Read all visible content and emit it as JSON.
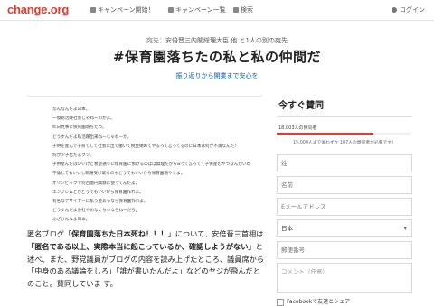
{
  "header_bar": {
    "logo": "change.org",
    "nav_start": "キャンペーン開始！",
    "nav_list": "キャンペーン一覧",
    "nav_search": "検索",
    "login": "ログイン"
  },
  "petition": {
    "addressee_label": "宛先：",
    "addressee": "安倍晋三内閣総理大臣 他 と1人の別の宛先",
    "title": "#保育園落ちたの私と私の仲間だ",
    "link": "振り返りから開業まで安心を"
  },
  "letter_lines": [
    "なんなんだよ日本。",
    "一億総活躍社会じゃねーのかよ。",
    "昨日見事に保育園落ちたわ。",
    "どうすんだよ私活躍出来ねーじゃねーか。",
    "子供を産んで子育てして社会に出て働いて税金納めてやるって言ってるのに日本は何が不満なんだ？",
    "何が少子化だよクソ。",
    "子供産んだはいいけど希望通りに保育園に預けるのほぼ無理だからwって言ってて子供産むやつなんかいねーよ。",
    "不倫してもいいし賄賂受け取るのもどうでもいいから保育園増やせよ。",
    "オリンピックで何百億円無駄に使ってんだよ。",
    "エンブレムとかどうでもいいから保育園作れよ。",
    "有名なデザイナーに払う金あるなら保育園作れよ。",
    "どうすんだよ会社やめなくちゃならねーだろ。",
    "ふざけんなよ日本。"
  ],
  "body": {
    "line1_pre": "匿名ブログ「",
    "line1_bold": "保育園落ちた日本死ね！！！",
    "line1_post": "」について、安倍晋三首相は",
    "line2_bold": "「匿名である以上、実際本当に起こっているか、確認しようがない」",
    "line2_post": "と",
    "line3": "述べ、また、野党議員がブログの内容を読み上げたところ、議員席から",
    "line4": "「中身のある議論をしろ」「誰が書いたんだよ」などのヤジが飛んだと",
    "line5": "のこと。",
    "line5_tail": "賛同していま す。"
  },
  "sidebar": {
    "title": "今すぐ賛同",
    "count_text": "18,003人の賛同者",
    "progress": 0.72,
    "needed_text": "15,000人まで後わずか 107人の賛同者が必要です！",
    "name_first_placeholder": "姓",
    "name_last_placeholder": "名前",
    "email_placeholder": "Eメールアドレス",
    "country": "日本",
    "postal_placeholder": "郵便番号",
    "comment_placeholder": "コメント（任意）",
    "share_label": "Facebookで友達とシェア"
  },
  "colors": {
    "brand": "#e23b2e",
    "link": "#1a5da8"
  }
}
